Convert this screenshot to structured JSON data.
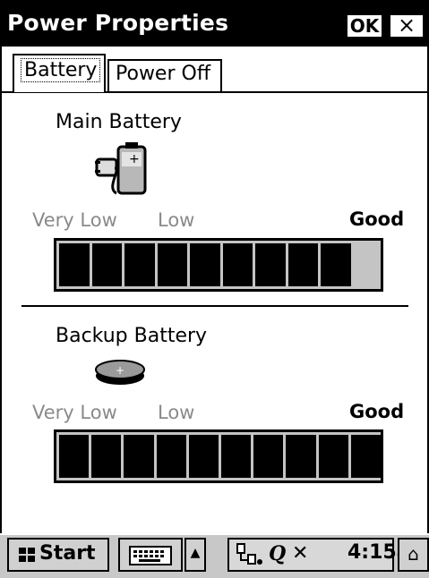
{
  "window": {
    "title": "Power Properties",
    "ok_label": "OK",
    "close_label": "×"
  },
  "tabs": [
    {
      "label": "Battery",
      "active": true
    },
    {
      "label": "Power Off",
      "active": false
    }
  ],
  "main_battery": {
    "title": "Main Battery",
    "icon": "plug-battery-icon",
    "scale": {
      "very_low": "Very Low",
      "low": "Low",
      "good": "Good"
    },
    "level_segments": 9,
    "total_segments": 10
  },
  "backup_battery": {
    "title": "Backup Battery",
    "icon": "coin-cell-battery-icon",
    "scale": {
      "very_low": "Very Low",
      "low": "Low",
      "good": "Good"
    },
    "level_segments": 10,
    "total_segments": 10
  },
  "taskbar": {
    "start_label": "Start",
    "keyboard_icon": "keyboard-icon",
    "input_menu_arrow": "▲",
    "tray_icons": [
      "network-icon",
      "connection-icon",
      "mute-icon"
    ],
    "clock": "4:15a",
    "corner_icon": "desktop-icon"
  },
  "colors": {
    "titlebar": "#000000",
    "bar_background": "#c4c4c4",
    "segment": "#000000",
    "scale_inactive": "#8a8a8a"
  }
}
